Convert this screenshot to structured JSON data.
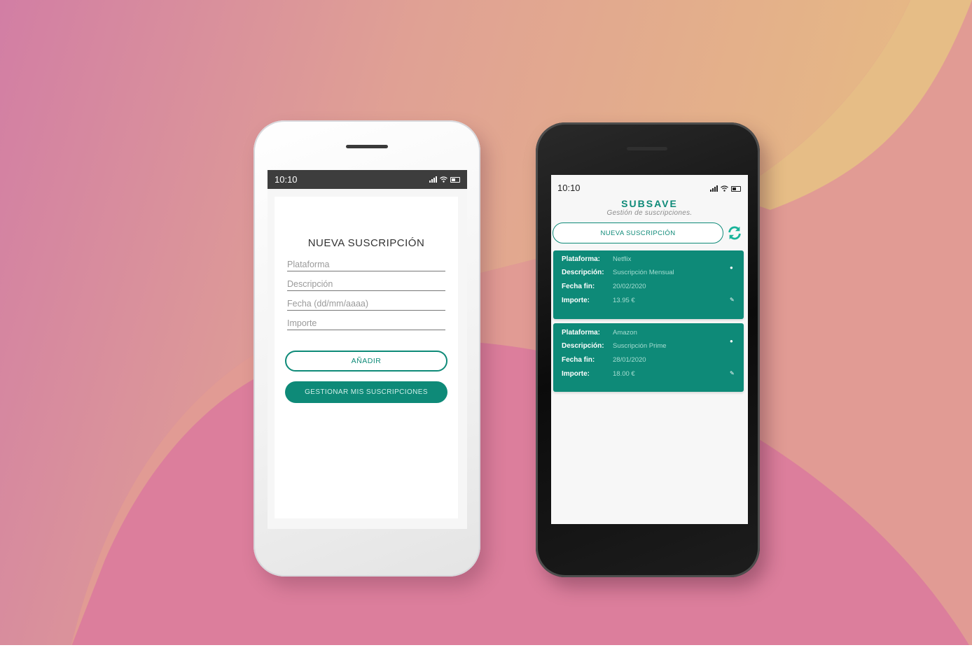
{
  "left_phone": {
    "status_time": "10:10",
    "form_title": "NUEVA SUSCRIPCIÓN",
    "fields": {
      "plataforma": "Plataforma",
      "descripcion": "Descripción",
      "fecha": "Fecha (dd/mm/aaaa)",
      "importe": "Importe"
    },
    "add_button": "AÑADIR",
    "manage_button": "GESTIONAR MIS SUSCRIPCIONES"
  },
  "right_phone": {
    "status_time": "10:10",
    "brand": "SUBSAVE",
    "tagline": "Gestión de suscripciones.",
    "new_button": "NUEVA SUSCRIPCIÓN",
    "labels": {
      "plataforma": "Plataforma:",
      "descripcion": "Descripción:",
      "fecha": "Fecha fin:",
      "importe": "Importe:"
    },
    "subscriptions": [
      {
        "plataforma": "Netflix",
        "descripcion": "Suscripción Mensual",
        "fecha": "20/02/2020",
        "importe": "13.95 €"
      },
      {
        "plataforma": "Amazon",
        "descripcion": "Suscripción Prime",
        "fecha": "28/01/2020",
        "importe": "18.00 €"
      }
    ]
  },
  "colors": {
    "accent": "#0e8a78",
    "background_pink": "#d98aa0",
    "background_peach": "#e2b08f"
  },
  "icons": [
    "signal-icon",
    "wifi-icon",
    "battery-icon",
    "refresh-icon",
    "delete-icon",
    "edit-icon"
  ]
}
